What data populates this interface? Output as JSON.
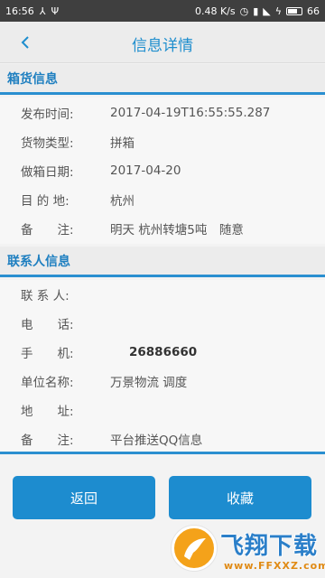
{
  "status_bar": {
    "time": "16:56",
    "network_speed": "0.48 K/s",
    "battery": "66"
  },
  "header": {
    "title": "信息详情"
  },
  "cargo_section": {
    "title": "箱货信息",
    "rows": [
      {
        "label": "发布时间:",
        "value": "2017-04-19T16:55:55.287"
      },
      {
        "label": "货物类型:",
        "value": "拼箱"
      },
      {
        "label": "做箱日期:",
        "value": "2017-04-20"
      },
      {
        "label": "目 的 地:",
        "value": "杭州"
      },
      {
        "label": "备　　注:",
        "value": "明天 杭州转塘5吨　随意"
      }
    ]
  },
  "contact_section": {
    "title": "联系人信息",
    "rows": [
      {
        "label": "联 系 人:",
        "value": ""
      },
      {
        "label": "电　　话:",
        "value": ""
      },
      {
        "label": "手　　机:",
        "value": "26886660"
      },
      {
        "label": "单位名称:",
        "value": "万景物流 调度"
      },
      {
        "label": "地　　址:",
        "value": ""
      },
      {
        "label": "备　　注:",
        "value": "平台推送QQ信息"
      }
    ]
  },
  "buttons": {
    "back": "返回",
    "favorite": "收藏"
  },
  "watermark": {
    "brand": "飞翔下载",
    "url": "www.FFXXZ.com"
  }
}
